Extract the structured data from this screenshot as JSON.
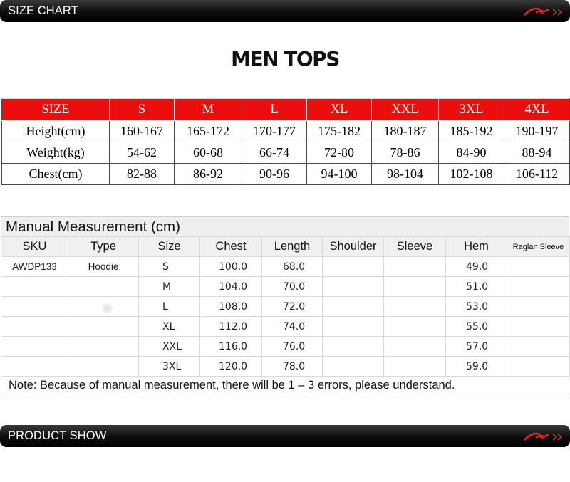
{
  "size_chart_banner": {
    "title": "SIZE CHART",
    "logo": "li-ning-logo"
  },
  "main_title": "MEN TOPS",
  "size_table": {
    "header": [
      "SIZE",
      "S",
      "M",
      "L",
      "XL",
      "XXL",
      "3XL",
      "4XL"
    ],
    "rows": [
      [
        "Height(cm)",
        "160-167",
        "165-172",
        "170-177",
        "175-182",
        "180-187",
        "185-192",
        "190-197"
      ],
      [
        "Weight(kg)",
        "54-62",
        "60-68",
        "66-74",
        "72-80",
        "78-86",
        "84-90",
        "88-94"
      ],
      [
        "Chest(cm)",
        "82-88",
        "86-92",
        "90-96",
        "94-100",
        "98-104",
        "102-108",
        "106-112"
      ]
    ],
    "header_color": "#ec0e0e"
  },
  "manual_measurement": {
    "title": "Manual Measurement (cm)",
    "columns": [
      "SKU",
      "Type",
      "Size",
      "Chest",
      "Length",
      "Shoulder",
      "Sleeve",
      "Hem",
      "Raglan Sleeve"
    ],
    "rows": [
      [
        "AWDP133",
        "Hoodie",
        "S",
        "100.0",
        "68.0",
        "",
        "",
        "49.0",
        ""
      ],
      [
        "",
        "",
        "M",
        "104.0",
        "70.0",
        "",
        "",
        "51.0",
        ""
      ],
      [
        "",
        "",
        "L",
        "108.0",
        "72.0",
        "",
        "",
        "53.0",
        ""
      ],
      [
        "",
        "",
        "XL",
        "112.0",
        "74.0",
        "",
        "",
        "55.0",
        ""
      ],
      [
        "",
        "",
        "XXL",
        "116.0",
        "76.0",
        "",
        "",
        "57.0",
        ""
      ],
      [
        "",
        "",
        "3XL",
        "120.0",
        "78.0",
        "",
        "",
        "59.0",
        ""
      ]
    ],
    "note": "Note: Because of manual measurement, there will be 1 – 3 errors, please understand."
  },
  "product_show_banner": {
    "title": "PRODUCT SHOW",
    "logo": "li-ning-logo"
  }
}
